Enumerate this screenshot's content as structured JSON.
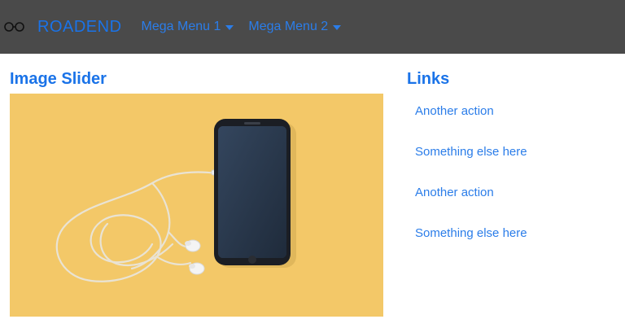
{
  "navbar": {
    "brand": "ROADEND",
    "brand_icon": "glasses-icon",
    "menus": [
      {
        "label": "Mega Menu 1"
      },
      {
        "label": "Mega Menu 2"
      }
    ]
  },
  "slider": {
    "title": "Image Slider",
    "image": "phone-with-earphones-image"
  },
  "links": {
    "title": "Links",
    "items": [
      {
        "label": "Another action"
      },
      {
        "label": "Something else here"
      },
      {
        "label": "Another action"
      },
      {
        "label": "Something else here"
      }
    ]
  },
  "colors": {
    "navbar_bg": "#4a4a4a",
    "accent": "#1a73e8",
    "slider_bg": "#f3c868"
  }
}
